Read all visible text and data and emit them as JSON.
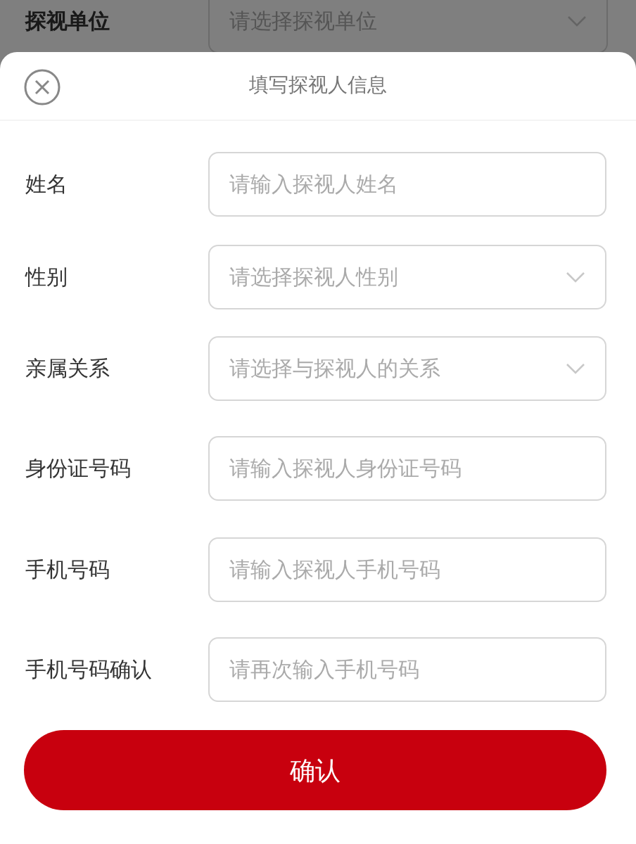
{
  "background_form": {
    "label": "探视单位",
    "placeholder": "请选择探视单位",
    "kind": "select"
  },
  "sheet": {
    "title": "填写探视人信息",
    "fields": [
      {
        "label": "姓名",
        "placeholder": "请输入探视人姓名",
        "kind": "input"
      },
      {
        "label": "性别",
        "placeholder": "请选择探视人性别",
        "kind": "select"
      },
      {
        "label": "亲属关系",
        "placeholder": "请选择与探视人的关系",
        "kind": "select"
      },
      {
        "label": "身份证号码",
        "placeholder": "请输入探视人身份证号码",
        "kind": "input"
      },
      {
        "label": "手机号码",
        "placeholder": "请输入探视人手机号码",
        "kind": "input"
      },
      {
        "label": "手机号码确认",
        "placeholder": "请再次输入手机号码",
        "kind": "input"
      }
    ],
    "confirm_button": "确认"
  }
}
